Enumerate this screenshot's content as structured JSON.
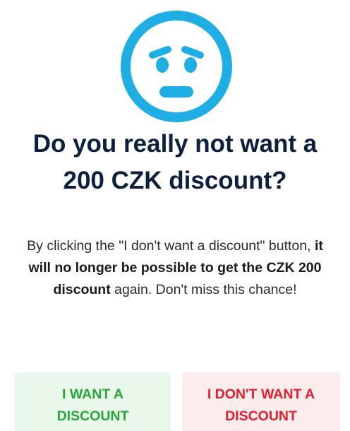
{
  "modal": {
    "title_line1": "Do you really not want a",
    "title_line2": "200 CZK discount?",
    "description": {
      "part1": "By clicking the \"I don't want a discount\" button, ",
      "bold": "it will no longer be possible to get the CZK 200 discount",
      "part2": " again. Don't miss this chance!"
    },
    "icon": "sad-face-icon",
    "buttons": {
      "accept_line1": "I WANT A",
      "accept_line2": "DISCOUNT",
      "decline_line1": "I DON'T WANT A",
      "decline_line2": "DISCOUNT"
    }
  },
  "colors": {
    "icon": "#1eaee4",
    "title": "#0d1f3f",
    "accept_text": "#27a63a",
    "accept_bg": "#e9f8ea",
    "decline_text": "#e0202f",
    "decline_bg": "#fdecec"
  }
}
